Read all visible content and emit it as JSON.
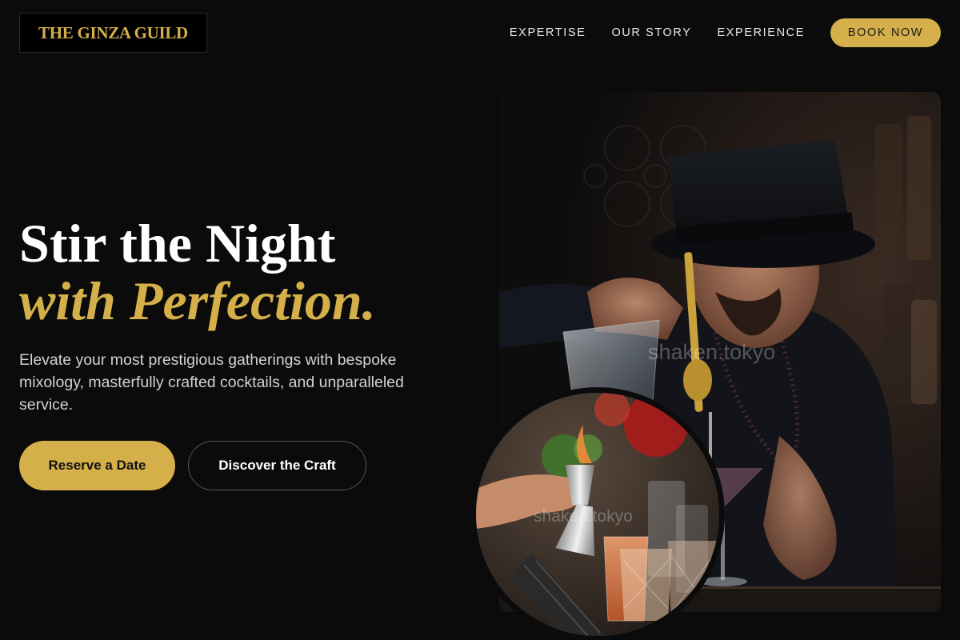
{
  "brand": {
    "logo_text": "THE GINZA GUILD"
  },
  "nav": {
    "links": [
      "EXPERTISE",
      "OUR STORY",
      "EXPERIENCE"
    ],
    "cta_label": "BOOK NOW"
  },
  "hero": {
    "headline_line1": "Stir the Night",
    "headline_line2": "with Perfection.",
    "subtext": "Elevate your most prestigious gatherings with bespoke mixology, masterfully crafted cocktails, and unparalleled service.",
    "primary_button": "Reserve a Date",
    "secondary_button": "Discover the Craft"
  },
  "images": {
    "main_watermark": "shaken.tokyo",
    "inset_watermark": "shaken.tokyo"
  },
  "colors": {
    "background": "#0b0b0b",
    "accent_gold": "#d4af4a",
    "text_primary": "#ffffff",
    "text_muted": "#d2d2d2"
  }
}
